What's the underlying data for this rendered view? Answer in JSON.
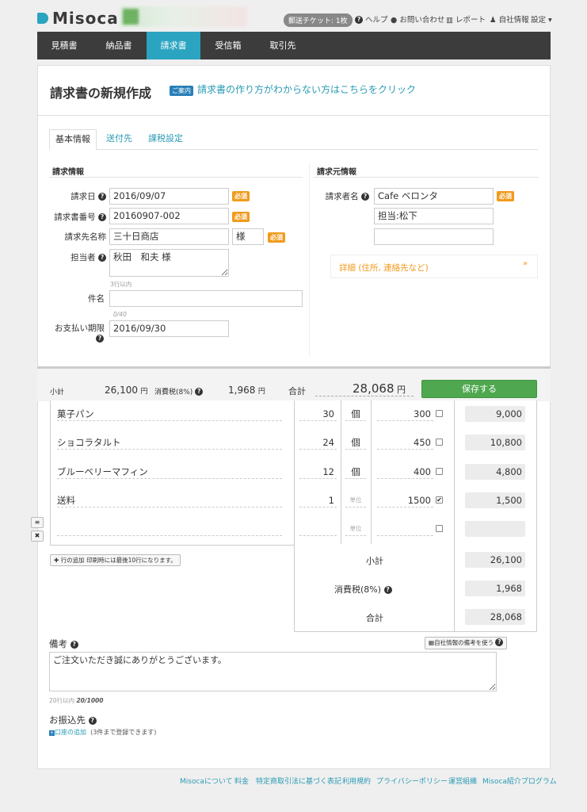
{
  "header": {
    "logo_text": "Misoca",
    "ticket_badge": "郵送チケット: 1枚",
    "links": [
      "ヘルプ",
      "お問い合わせ",
      "レポート",
      "自社情報",
      "設定"
    ]
  },
  "nav": {
    "items": [
      "見積書",
      "納品書",
      "請求書",
      "受信箱",
      "取引先"
    ],
    "active": "請求書"
  },
  "page": {
    "title": "請求書の新規作成",
    "guide_badge": "ご案内",
    "guide_link": "請求書の作り方がわからない方はこちらをクリック"
  },
  "tabs": [
    "基本情報",
    "送付先",
    "課税設定"
  ],
  "billing_info": {
    "heading": "請求情報",
    "date_label": "請求日",
    "date_value": "2016/09/07",
    "number_label": "請求書番号",
    "number_value": "20160907-002",
    "client_label": "請求先名称",
    "client_value": "三十日商店",
    "honorific": "様",
    "contact_label": "担当者",
    "contact_value": "秋田　和夫 様",
    "contact_hint": "3行以内",
    "subject_label": "件名",
    "subject_value": "",
    "subject_hint": "0/40",
    "due_label": "お支払い期限",
    "due_value": "2016/09/30",
    "required": "必須"
  },
  "issuer_info": {
    "heading": "請求元情報",
    "name_label": "請求者名",
    "name_value": "Cafe ベロンタ",
    "contact_value": "担当:松下",
    "extra_value": "",
    "detail_label": "詳細 (住所, 連絡先など)"
  },
  "summary": {
    "subtotal_label": "小計",
    "subtotal_value": "26,100",
    "tax_label": "消費税(8%)",
    "tax_value": "1,968",
    "total_label": "合計",
    "total_value": "28,068",
    "yen": "円",
    "save_label": "保存する"
  },
  "items": [
    {
      "name": "菓子パン",
      "qty": "30",
      "unit": "個",
      "price": "300",
      "tax": false,
      "amount": "9,000"
    },
    {
      "name": "ショコラタルト",
      "qty": "24",
      "unit": "個",
      "price": "450",
      "tax": false,
      "amount": "10,800"
    },
    {
      "name": "ブルーベリーマフィン",
      "qty": "12",
      "unit": "個",
      "price": "400",
      "tax": false,
      "amount": "4,800"
    },
    {
      "name": "送料",
      "qty": "1",
      "unit": "単位",
      "price": "1500",
      "tax": true,
      "amount": "1,500"
    },
    {
      "name": "",
      "qty": "",
      "unit": "単位",
      "price": "",
      "tax": false,
      "amount": ""
    }
  ],
  "add_row": {
    "label": "行の追加",
    "note": "印刷時には最後10行になります。"
  },
  "totals": {
    "subtotal_label": "小計",
    "subtotal_value": "26,100",
    "tax_label": "消費税(8%)",
    "tax_value": "1,968",
    "total_label": "合計",
    "total_value": "28,068"
  },
  "remarks": {
    "label": "備考",
    "company_button": "自社情報の備考を使う",
    "value": "ご注文いただき誠にありがとうございます。",
    "hint_prefix": "20行以内",
    "hint_count": "20/1000"
  },
  "bank": {
    "label": "お振込先",
    "add_label": "口座の追加",
    "note": "(3件まで登録できます)"
  },
  "footer": [
    "Misocaについて",
    "料金",
    "特定商取引法に基づく表記",
    "利用規約",
    "プライバシーポリシー",
    "運営組織",
    "Misoca紹介プログラム"
  ]
}
